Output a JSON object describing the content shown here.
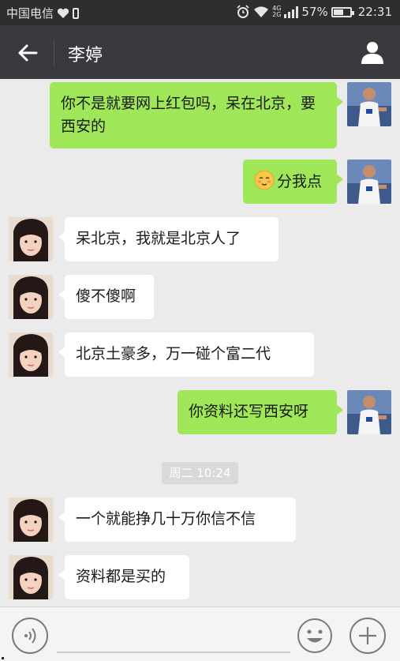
{
  "status_bar": {
    "carrier": "中国电信",
    "network": [
      "4G",
      "2G"
    ],
    "battery_percent": "57%",
    "battery_level": 0.57,
    "time": "22:31",
    "icons": [
      "heart-icon",
      "phone-icon",
      "alarm-icon",
      "wifi-icon",
      "signal-icon",
      "battery-icon"
    ]
  },
  "header": {
    "title": "李婷",
    "icons": [
      "back-arrow-icon",
      "profile-icon"
    ]
  },
  "messages": [
    {
      "side": "out",
      "text": "你不是就要网上红包吗，呆在北京，要西安的"
    },
    {
      "side": "out",
      "emoji": "blushing-face-icon",
      "text": "分我点"
    },
    {
      "side": "in",
      "text": "呆北京，我就是北京人了"
    },
    {
      "side": "in",
      "text": "傻不傻啊"
    },
    {
      "side": "in",
      "text": "北京土豪多，万一碰个富二代"
    },
    {
      "side": "out",
      "text": "你资料还写西安呀"
    },
    {
      "side": "in",
      "text": "一个就能挣几十万你信不信"
    },
    {
      "side": "in",
      "text": "资料都是买的"
    }
  ],
  "timestamp": "周二 10:24",
  "input_bar": {
    "icons": [
      "voice-icon",
      "emoji-icon",
      "plus-icon"
    ]
  },
  "colors": {
    "outgoing_bubble": "#9fe658",
    "incoming_bubble": "#ffffff",
    "header": "#393a3e",
    "chat_background": "#ebebeb"
  }
}
